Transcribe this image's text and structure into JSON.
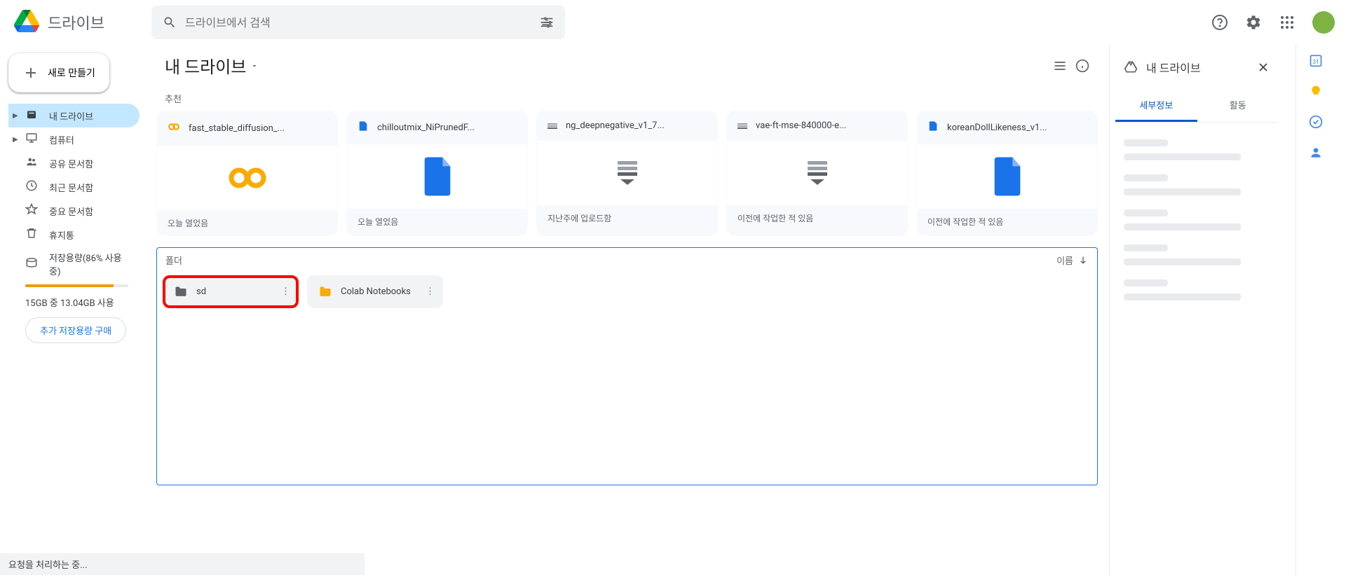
{
  "app": {
    "name": "드라이브"
  },
  "search": {
    "placeholder": "드라이브에서 검색"
  },
  "newButton": "새로 만들기",
  "nav": [
    {
      "label": "내 드라이브",
      "icon": "drive-fill",
      "active": true,
      "expandable": true
    },
    {
      "label": "컴퓨터",
      "icon": "computer",
      "expandable": true
    },
    {
      "label": "공유 문서함",
      "icon": "shared"
    },
    {
      "label": "최근 문서함",
      "icon": "recent"
    },
    {
      "label": "중요 문서함",
      "icon": "star"
    },
    {
      "label": "휴지통",
      "icon": "trash"
    },
    {
      "label": "저장용량(86% 사용 중)",
      "icon": "storage"
    }
  ],
  "storage": {
    "text": "15GB 중 13.04GB 사용",
    "percent": 86,
    "buy": "추가 저장용량 구매"
  },
  "main": {
    "title": "내 드라이브",
    "suggestedLabel": "추천",
    "sortLabel": "이름",
    "suggested": [
      {
        "name": "fast_stable_diffusion_...",
        "type": "colab",
        "status": "오늘 열었음",
        "icon": "colab"
      },
      {
        "name": "chilloutmix_NiPrunedF...",
        "type": "file",
        "status": "오늘 열었음",
        "icon": "file"
      },
      {
        "name": "ng_deepnegative_v1_7...",
        "type": "binary",
        "status": "지난주에 업로드함",
        "icon": "binary"
      },
      {
        "name": "vae-ft-mse-840000-e...",
        "type": "binary",
        "status": "이전에 작업한 적 있음",
        "icon": "binary"
      },
      {
        "name": "koreanDollLikeness_v1...",
        "type": "file",
        "status": "이전에 작업한 적 있음",
        "icon": "file"
      }
    ],
    "foldersLabel": "폴더",
    "folders": [
      {
        "name": "sd",
        "highlight": true
      },
      {
        "name": "Colab Notebooks",
        "highlight": false
      }
    ]
  },
  "details": {
    "title": "내 드라이브",
    "tabs": [
      "세부정보",
      "활동"
    ],
    "activeTab": 0
  },
  "status": "요청을 처리하는 중..."
}
